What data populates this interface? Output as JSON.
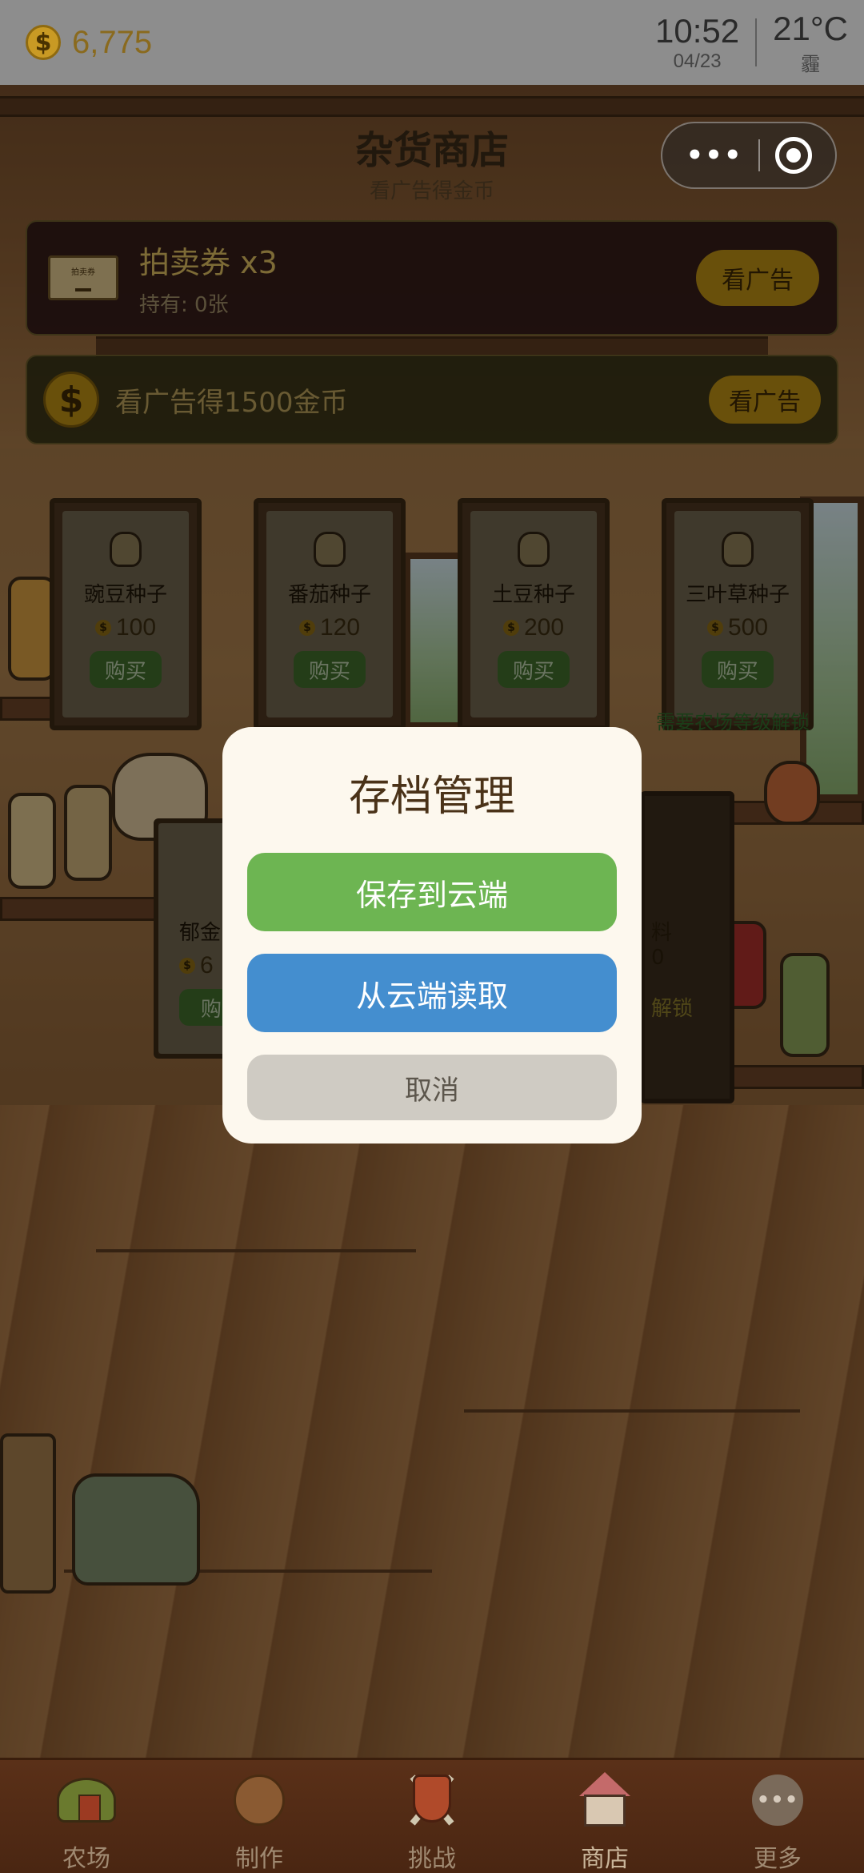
{
  "status": {
    "coins": "6,775",
    "coin_symbol": "$",
    "time": "10:52",
    "date": "04/23",
    "temperature": "21°C",
    "weather": "霾"
  },
  "header": {
    "title": "杂货商店",
    "subtitle": "看广告得金币"
  },
  "capsule": {
    "more_glyph": "•••",
    "close_glyph": ""
  },
  "auction_banner": {
    "ticket_label": "拍卖券",
    "title": "拍卖券 x3",
    "owned": "持有: 0张",
    "button": "看广告"
  },
  "gold_banner": {
    "coin_symbol": "$",
    "text": "看广告得1500金币",
    "button": "看广告"
  },
  "seeds": [
    {
      "name": "豌豆种子",
      "price": "100",
      "buy": "购买"
    },
    {
      "name": "番茄种子",
      "price": "120",
      "buy": "购买"
    },
    {
      "name": "土豆种子",
      "price": "200",
      "buy": "购买"
    },
    {
      "name": "三叶草种子",
      "price": "500",
      "buy": "购买"
    }
  ],
  "unlock_note": "需要农场等级解锁",
  "partial_items": {
    "left_name": "郁金",
    "left_price": "6",
    "left_buy": "购",
    "right_name": "料",
    "right_price": "0",
    "right_unlock": "解锁"
  },
  "modal": {
    "title": "存档管理",
    "save_button": "保存到云端",
    "load_button": "从云端读取",
    "cancel_button": "取消"
  },
  "tabs": [
    {
      "label": "农场",
      "icon": "farm-icon"
    },
    {
      "label": "制作",
      "icon": "craft-icon"
    },
    {
      "label": "挑战",
      "icon": "challenge-icon"
    },
    {
      "label": "商店",
      "icon": "shop-icon",
      "active": true
    },
    {
      "label": "更多",
      "icon": "more-icon",
      "glyph": "•••"
    }
  ],
  "colors": {
    "save": "#6db552",
    "load": "#448ecf",
    "cancel": "#cfcbc3",
    "modal_bg": "#fdf8ee",
    "gold": "#b68a14"
  }
}
